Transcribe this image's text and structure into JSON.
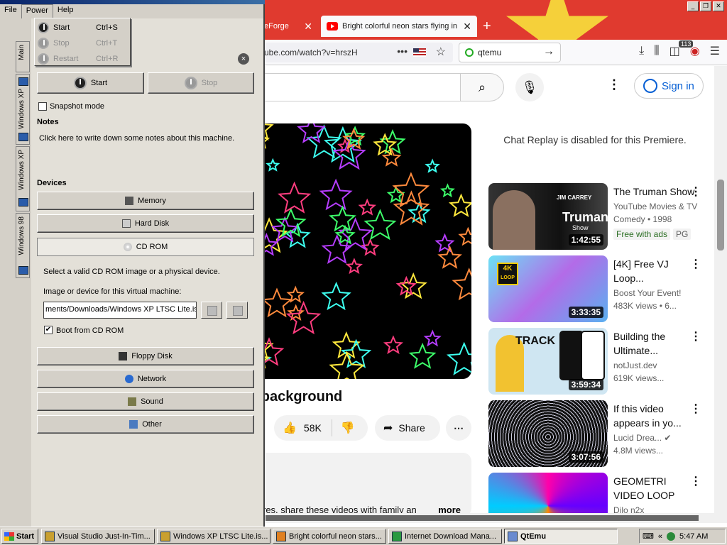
{
  "browser": {
    "tabs": [
      {
        "label": "eForge",
        "close": "✕"
      },
      {
        "label": "Bright colorful neon stars flying in",
        "close": "✕"
      }
    ],
    "new_tab": "+",
    "url": "ube.com/watch?v=hrszH",
    "search_value": "qtemu",
    "badge": "113"
  },
  "youtube": {
    "sign_in": "Sign in",
    "chat_replay": "Chat Replay is disabled for this Premiere.",
    "video_title": "ck background",
    "likes": "58K",
    "share": "Share",
    "desc_text": "res, share these videos with family an",
    "desc_more": "more",
    "recommendations": [
      {
        "title": "The Truman Show",
        "meta1": "YouTube Movies & TV",
        "meta2": "Comedy • 1998",
        "chip1": "Free with ads",
        "chip2": "PG",
        "duration": "1:42:55"
      },
      {
        "title": "[4K] Free VJ Loop...",
        "meta1": "Boost Your Event!",
        "meta2": "483K views  • 6...",
        "duration": "3:33:35"
      },
      {
        "title": "Building the Ultimate...",
        "meta1": "notJust.dev",
        "meta2": "619K views...",
        "duration": "3:59:34"
      },
      {
        "title": "If this video appears in yo...",
        "meta1": "Lucid Drea...",
        "meta2": "4.8M views...",
        "duration": "3:07:56"
      },
      {
        "title": "GEOMETRI VIDEO LOOP",
        "meta1": "Dilo n2x",
        "meta2": "",
        "duration": ""
      }
    ],
    "thumb_texts": {
      "truman_name": "JIM CARREY",
      "truman_logo": "Truman",
      "truman_sub": "Show",
      "fourk": "4K",
      "loop": "LOOP",
      "track": "TRACK"
    }
  },
  "qtemu": {
    "menu": {
      "file": "File",
      "power": "Power",
      "help": "Help"
    },
    "power_menu": [
      {
        "label": "Start",
        "shortcut": "Ctrl+S",
        "enabled": true
      },
      {
        "label": "Stop",
        "shortcut": "Ctrl+T",
        "enabled": false
      },
      {
        "label": "Restart",
        "shortcut": "Ctrl+R",
        "enabled": false
      }
    ],
    "side_tabs": [
      "Main",
      "Windows XP",
      "Windows XP",
      "Windows 98"
    ],
    "close_icon": "×",
    "start_label": "Start",
    "stop_label": "Stop",
    "snapshot_label": "Snapshot mode",
    "notes_heading": "Notes",
    "notes_text": "Click here to write down some notes about this machine.",
    "devices_heading": "Devices",
    "devices": [
      "Memory",
      "Hard Disk",
      "CD ROM",
      "Floppy Disk",
      "Network",
      "Sound",
      "Other"
    ],
    "cdrom_help": "Select a valid CD ROM image or a physical device.",
    "image_label": "Image or device for this virtual machine:",
    "image_value": "ments/Downloads/Windows XP LTSC Lite.iso",
    "boot_label": "Boot from CD ROM",
    "boot_checked": "✔",
    "snapshot_checked": ""
  },
  "taskbar": {
    "start": "Start",
    "tasks": [
      "Visual Studio Just-In-Tim...",
      "Windows XP LTSC Lite.is...",
      "Bright colorful neon stars...",
      "Internet Download Mana...",
      "QtEmu"
    ],
    "tray_chevron": "«",
    "clock": "5:47 AM"
  },
  "colors": {
    "brand_red": "#e03a2f",
    "yt_blue": "#065fd4",
    "xp_face": "#d4d0c8"
  }
}
